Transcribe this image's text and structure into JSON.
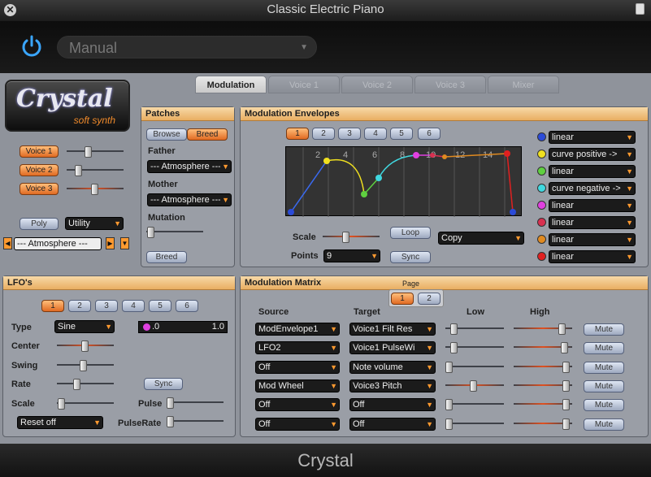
{
  "window": {
    "title": "Classic Electric Piano"
  },
  "host": {
    "preset": "Manual"
  },
  "footer": {
    "title": "Crystal"
  },
  "logo": {
    "main": "Crystal",
    "sub": "soft synth"
  },
  "tabs": [
    "Modulation",
    "Voice 1",
    "Voice 2",
    "Voice 3",
    "Mixer"
  ],
  "left": {
    "voices": [
      "Voice 1",
      "Voice 2",
      "Voice 3"
    ],
    "poly": "Poly",
    "utility": "Utility",
    "preset": "--- Atmosphere ---"
  },
  "patches": {
    "title": "Patches",
    "browse": "Browse",
    "breed": "Breed",
    "father_label": "Father",
    "father": "--- Atmosphere ---",
    "mother_label": "Mother",
    "mother": "--- Atmosphere ---",
    "mutation_label": "Mutation",
    "breed_btn": "Breed"
  },
  "envelopes": {
    "title": "Modulation Envelopes",
    "pages": [
      "1",
      "2",
      "3",
      "4",
      "5",
      "6"
    ],
    "graph_labels": [
      "2",
      "4",
      "6",
      "8",
      "10",
      "12",
      "14"
    ],
    "scale_label": "Scale",
    "points_label": "Points",
    "points": "9",
    "loop": "Loop",
    "sync": "Sync",
    "copy": "Copy",
    "curves": [
      {
        "color": "#2b4bd8",
        "label": "linear"
      },
      {
        "color": "#f0e020",
        "label": "curve positive ->"
      },
      {
        "color": "#5fd040",
        "label": "linear"
      },
      {
        "color": "#40d8e0",
        "label": "curve negative ->"
      },
      {
        "color": "#e040e0",
        "label": "linear"
      },
      {
        "color": "#d83050",
        "label": "linear"
      },
      {
        "color": "#e08a20",
        "label": "linear"
      },
      {
        "color": "#e02020",
        "label": "linear"
      }
    ]
  },
  "lfo": {
    "title": "LFO's",
    "pages": [
      "1",
      "2",
      "3",
      "4",
      "5",
      "6"
    ],
    "type_label": "Type",
    "type": "Sine",
    "range_low": ".0",
    "range_high": "1.0",
    "center_label": "Center",
    "swing_label": "Swing",
    "rate_label": "Rate",
    "sync": "Sync",
    "scale_label": "Scale",
    "pulse_label": "Pulse",
    "pulserate_label": "PulseRate",
    "reset": "Reset off"
  },
  "matrix": {
    "title": "Modulation Matrix",
    "page_label": "Page",
    "pages": [
      "1",
      "2"
    ],
    "headers": {
      "source": "Source",
      "target": "Target",
      "low": "Low",
      "high": "High"
    },
    "mute": "Mute",
    "rows": [
      {
        "source": "ModEnvelope1",
        "target": "Voice1 Filt Res"
      },
      {
        "source": "LFO2",
        "target": "Voice1 PulseWi"
      },
      {
        "source": "Off",
        "target": "Note volume"
      },
      {
        "source": "Mod Wheel",
        "target": "Voice3 Pitch"
      },
      {
        "source": "Off",
        "target": "Off"
      },
      {
        "source": "Off",
        "target": "Off"
      }
    ]
  }
}
